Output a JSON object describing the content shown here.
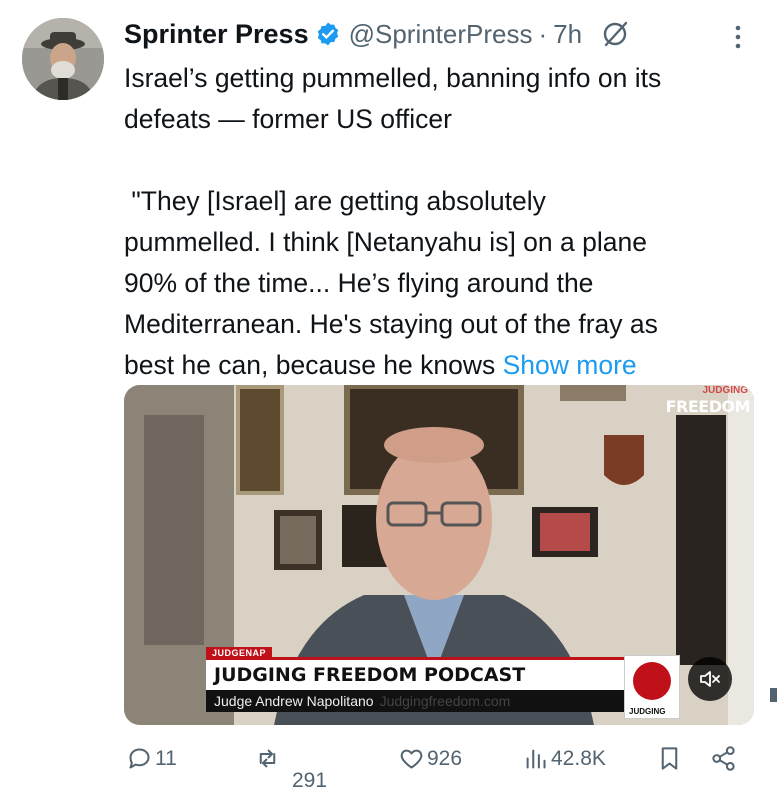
{
  "author": {
    "name": "Sprinter Press",
    "handle": "@SprinterPress",
    "separator": "·",
    "time": "7h",
    "verified_icon": "verified-badge-icon",
    "grok_icon": "grok-slash-icon"
  },
  "tweet": {
    "lines": [
      "Israel’s getting pummelled, banning info on its",
      "defeats — former US officer",
      " \"They [Israel] are getting absolutely",
      "pummelled. I think [Netanyahu is] on a plane",
      "90% of the time... He’s flying around the",
      "Mediterranean. He's staying out of the fray as",
      "best he can, because he knows"
    ],
    "show_more": "Show more"
  },
  "media": {
    "brand_top": "JUDGING",
    "brand_main": "FREEDOM",
    "lower_third_tag": "JUDGENAP",
    "lower_third_title": "JUDGING FREEDOM PODCAST",
    "lower_third_subtitle": "Judge Andrew Napolitano",
    "lower_third_ghost": "Judgingfreedom.com",
    "corner_badge": "JUDGING",
    "mute_icon": "speaker-muted-icon"
  },
  "actions": {
    "replies": "11",
    "reposts": "291",
    "likes": "926",
    "views": "42.8K"
  },
  "colors": {
    "text": "#0f1419",
    "secondary": "#536471",
    "link": "#1d9bf0",
    "verified": "#1d9bf0",
    "brand_red": "#c0111a"
  }
}
